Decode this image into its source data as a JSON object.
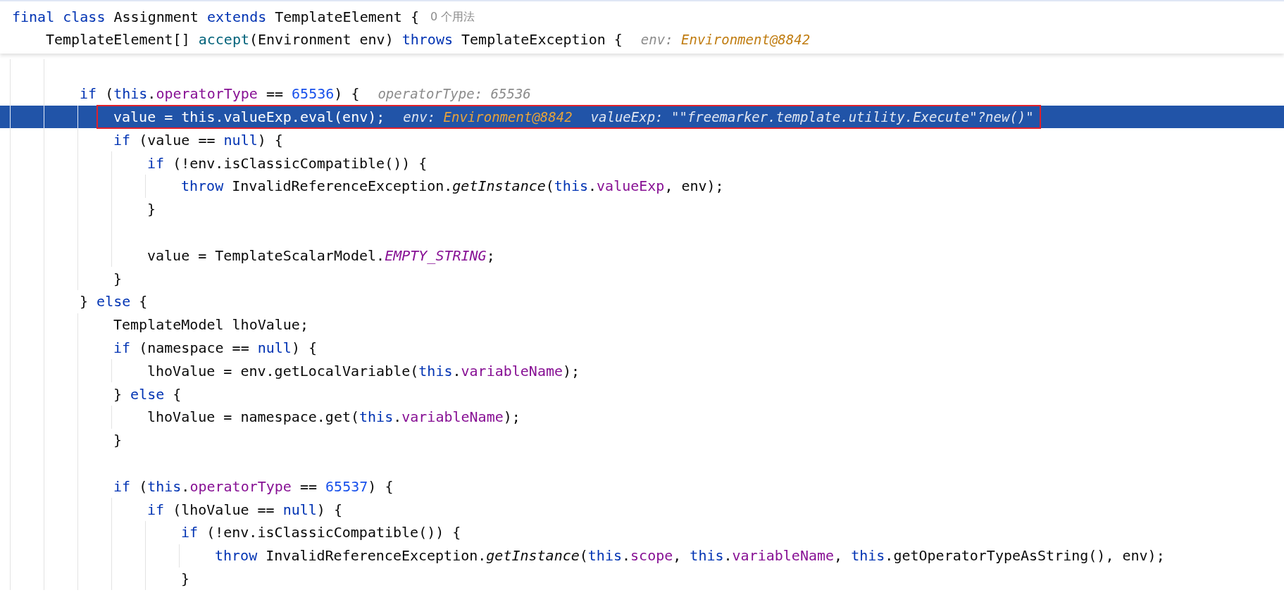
{
  "sticky_header": [
    {
      "kind": "code",
      "tokens": [
        {
          "kind": "keyword",
          "text": "final class"
        },
        {
          "kind": "plain",
          "text": " Assignment "
        },
        {
          "kind": "keyword",
          "text": "extends"
        },
        {
          "kind": "plain",
          "text": " TemplateElement {"
        }
      ],
      "usage": "0 个用法",
      "children": [
        {
          "kind": "code",
          "tokens": [
            {
              "kind": "plain",
              "text": "TemplateElement[] "
            },
            {
              "kind": "method_decl",
              "text": "accept"
            },
            {
              "kind": "plain",
              "text": "(Environment env) "
            },
            {
              "kind": "keyword",
              "text": "throws"
            },
            {
              "kind": "plain",
              "text": " TemplateException {"
            }
          ],
          "hints": [
            {
              "label": "env:",
              "value": "Environment@8842",
              "kind": "object"
            }
          ]
        }
      ]
    }
  ],
  "lines": [
    {
      "kind": "blank"
    },
    {
      "kind": "code",
      "selected": false,
      "framed": false,
      "tokens": [
        {
          "kind": "keyword",
          "text": "if"
        },
        {
          "kind": "plain",
          "text": " ("
        },
        {
          "kind": "keyword",
          "text": "this"
        },
        {
          "kind": "plain",
          "text": "."
        },
        {
          "kind": "field",
          "text": "operatorType"
        },
        {
          "kind": "plain",
          "text": " == "
        },
        {
          "kind": "number",
          "text": "65536"
        },
        {
          "kind": "plain",
          "text": ") {"
        }
      ],
      "hints": [
        {
          "label": "operatorType:",
          "value": "65536",
          "kind": "text"
        }
      ],
      "children": [
        {
          "kind": "code",
          "selected": true,
          "framed": true,
          "tokens": [
            {
              "kind": "plain",
              "text": "value = "
            },
            {
              "kind": "keyword",
              "text": "this"
            },
            {
              "kind": "plain",
              "text": ".valueExp.eval(env);"
            }
          ],
          "hints": [
            {
              "label": "env:",
              "value": "Environment@8842",
              "kind": "object"
            },
            {
              "label": "valueExp:",
              "value": "\"\"freemarker.template.utility.Execute\"?new()\"",
              "kind": "text"
            }
          ]
        },
        {
          "kind": "code",
          "selected": false,
          "framed": false,
          "tokens": [
            {
              "kind": "keyword",
              "text": "if"
            },
            {
              "kind": "plain",
              "text": " (value == "
            },
            {
              "kind": "keyword",
              "text": "null"
            },
            {
              "kind": "plain",
              "text": ") {"
            }
          ],
          "children": [
            {
              "kind": "code",
              "selected": false,
              "framed": false,
              "tokens": [
                {
                  "kind": "keyword",
                  "text": "if"
                },
                {
                  "kind": "plain",
                  "text": " (!env.isClassicCompatible()) {"
                }
              ],
              "children": [
                {
                  "kind": "code",
                  "selected": false,
                  "framed": false,
                  "tokens": [
                    {
                      "kind": "keyword",
                      "text": "throw"
                    },
                    {
                      "kind": "plain",
                      "text": " InvalidReferenceException."
                    },
                    {
                      "kind": "static_call",
                      "text": "getInstance"
                    },
                    {
                      "kind": "plain",
                      "text": "("
                    },
                    {
                      "kind": "keyword",
                      "text": "this"
                    },
                    {
                      "kind": "plain",
                      "text": "."
                    },
                    {
                      "kind": "field",
                      "text": "valueExp"
                    },
                    {
                      "kind": "plain",
                      "text": ", env);"
                    }
                  ]
                }
              ]
            },
            {
              "kind": "code",
              "selected": false,
              "framed": false,
              "tokens": [
                {
                  "kind": "plain",
                  "text": "}"
                }
              ]
            },
            {
              "kind": "blank"
            },
            {
              "kind": "code",
              "selected": false,
              "framed": false,
              "tokens": [
                {
                  "kind": "plain",
                  "text": "value = TemplateScalarModel."
                },
                {
                  "kind": "constant",
                  "text": "EMPTY_STRING"
                },
                {
                  "kind": "plain",
                  "text": ";"
                }
              ]
            }
          ]
        },
        {
          "kind": "code",
          "selected": false,
          "framed": false,
          "tokens": [
            {
              "kind": "plain",
              "text": "}"
            }
          ]
        }
      ]
    },
    {
      "kind": "code",
      "selected": false,
      "framed": false,
      "tokens": [
        {
          "kind": "plain",
          "text": "} "
        },
        {
          "kind": "keyword",
          "text": "else"
        },
        {
          "kind": "plain",
          "text": " {"
        }
      ],
      "children": [
        {
          "kind": "code",
          "selected": false,
          "framed": false,
          "tokens": [
            {
              "kind": "plain",
              "text": "TemplateModel lhoValue;"
            }
          ]
        },
        {
          "kind": "code",
          "selected": false,
          "framed": false,
          "tokens": [
            {
              "kind": "keyword",
              "text": "if"
            },
            {
              "kind": "plain",
              "text": " (namespace == "
            },
            {
              "kind": "keyword",
              "text": "null"
            },
            {
              "kind": "plain",
              "text": ") {"
            }
          ],
          "children": [
            {
              "kind": "code",
              "selected": false,
              "framed": false,
              "tokens": [
                {
                  "kind": "plain",
                  "text": "lhoValue = env.getLocalVariable("
                },
                {
                  "kind": "keyword",
                  "text": "this"
                },
                {
                  "kind": "plain",
                  "text": "."
                },
                {
                  "kind": "field",
                  "text": "variableName"
                },
                {
                  "kind": "plain",
                  "text": ");"
                }
              ]
            }
          ]
        },
        {
          "kind": "code",
          "selected": false,
          "framed": false,
          "tokens": [
            {
              "kind": "plain",
              "text": "} "
            },
            {
              "kind": "keyword",
              "text": "else"
            },
            {
              "kind": "plain",
              "text": " {"
            }
          ],
          "children": [
            {
              "kind": "code",
              "selected": false,
              "framed": false,
              "tokens": [
                {
                  "kind": "plain",
                  "text": "lhoValue = namespace.get("
                },
                {
                  "kind": "keyword",
                  "text": "this"
                },
                {
                  "kind": "plain",
                  "text": "."
                },
                {
                  "kind": "field",
                  "text": "variableName"
                },
                {
                  "kind": "plain",
                  "text": ");"
                }
              ]
            }
          ]
        },
        {
          "kind": "code",
          "selected": false,
          "framed": false,
          "tokens": [
            {
              "kind": "plain",
              "text": "}"
            }
          ]
        },
        {
          "kind": "blank"
        },
        {
          "kind": "code",
          "selected": false,
          "framed": false,
          "tokens": [
            {
              "kind": "keyword",
              "text": "if"
            },
            {
              "kind": "plain",
              "text": " ("
            },
            {
              "kind": "keyword",
              "text": "this"
            },
            {
              "kind": "plain",
              "text": "."
            },
            {
              "kind": "field",
              "text": "operatorType"
            },
            {
              "kind": "plain",
              "text": " == "
            },
            {
              "kind": "number",
              "text": "65537"
            },
            {
              "kind": "plain",
              "text": ") {"
            }
          ],
          "children": [
            {
              "kind": "code",
              "selected": false,
              "framed": false,
              "tokens": [
                {
                  "kind": "keyword",
                  "text": "if"
                },
                {
                  "kind": "plain",
                  "text": " (lhoValue == "
                },
                {
                  "kind": "keyword",
                  "text": "null"
                },
                {
                  "kind": "plain",
                  "text": ") {"
                }
              ],
              "children": [
                {
                  "kind": "code",
                  "selected": false,
                  "framed": false,
                  "tokens": [
                    {
                      "kind": "keyword",
                      "text": "if"
                    },
                    {
                      "kind": "plain",
                      "text": " (!env.isClassicCompatible()) {"
                    }
                  ],
                  "children": [
                    {
                      "kind": "code",
                      "selected": false,
                      "framed": false,
                      "tokens": [
                        {
                          "kind": "keyword",
                          "text": "throw"
                        },
                        {
                          "kind": "plain",
                          "text": " InvalidReferenceException."
                        },
                        {
                          "kind": "static_call",
                          "text": "getInstance"
                        },
                        {
                          "kind": "plain",
                          "text": "("
                        },
                        {
                          "kind": "keyword",
                          "text": "this"
                        },
                        {
                          "kind": "plain",
                          "text": "."
                        },
                        {
                          "kind": "field",
                          "text": "scope"
                        },
                        {
                          "kind": "plain",
                          "text": ", "
                        },
                        {
                          "kind": "keyword",
                          "text": "this"
                        },
                        {
                          "kind": "plain",
                          "text": "."
                        },
                        {
                          "kind": "field",
                          "text": "variableName"
                        },
                        {
                          "kind": "plain",
                          "text": ", "
                        },
                        {
                          "kind": "keyword",
                          "text": "this"
                        },
                        {
                          "kind": "plain",
                          "text": ".getOperatorTypeAsString(), env);"
                        }
                      ]
                    }
                  ]
                },
                {
                  "kind": "code",
                  "selected": false,
                  "framed": false,
                  "tokens": [
                    {
                      "kind": "plain",
                      "text": "}"
                    }
                  ]
                }
              ]
            }
          ]
        }
      ]
    }
  ]
}
